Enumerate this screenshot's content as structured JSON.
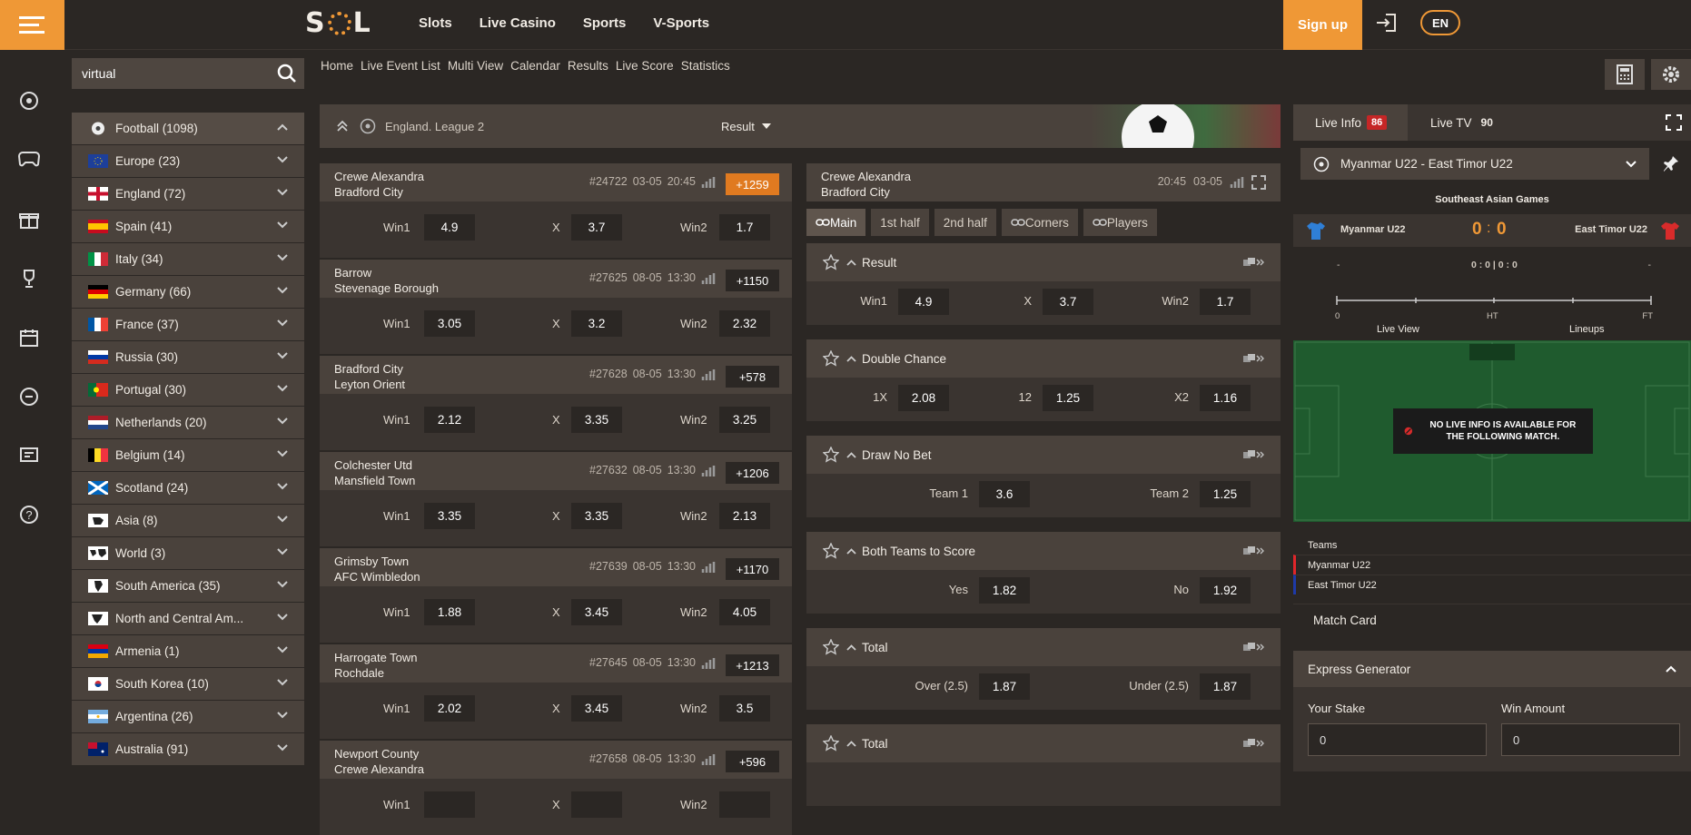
{
  "header": {
    "logo_text": "SOL",
    "nav": [
      "Slots",
      "Live Casino",
      "Sports",
      "V-Sports"
    ],
    "signup_label": "Sign up",
    "lang": "EN"
  },
  "search": {
    "value": "virtual"
  },
  "subnav": [
    "Home",
    "Live Event List",
    "Multi View",
    "Calendar",
    "Results",
    "Live Score",
    "Statistics"
  ],
  "sidebar": {
    "items": [
      {
        "label": "Football (1098)",
        "flag": "football"
      },
      {
        "label": "Europe (23)",
        "flag": "eu"
      },
      {
        "label": "England (72)",
        "flag": "england"
      },
      {
        "label": "Spain (41)",
        "flag": "spain"
      },
      {
        "label": "Italy (34)",
        "flag": "italy"
      },
      {
        "label": "Germany (66)",
        "flag": "germany"
      },
      {
        "label": "France (37)",
        "flag": "france"
      },
      {
        "label": "Russia (30)",
        "flag": "russia"
      },
      {
        "label": "Portugal (30)",
        "flag": "portugal"
      },
      {
        "label": "Netherlands (20)",
        "flag": "netherlands"
      },
      {
        "label": "Belgium (14)",
        "flag": "belgium"
      },
      {
        "label": "Scotland (24)",
        "flag": "scotland"
      },
      {
        "label": "Asia (8)",
        "flag": "asia"
      },
      {
        "label": "World (3)",
        "flag": "world"
      },
      {
        "label": "South America (35)",
        "flag": "samerica"
      },
      {
        "label": "North and Central Am...",
        "flag": "namerica"
      },
      {
        "label": "Armenia (1)",
        "flag": "armenia"
      },
      {
        "label": "South Korea (10)",
        "flag": "korea"
      },
      {
        "label": "Argentina (26)",
        "flag": "argentina"
      },
      {
        "label": "Australia (91)",
        "flag": "australia"
      }
    ]
  },
  "league": {
    "name": "England. League 2",
    "market_select": "Result"
  },
  "matches": [
    {
      "home": "Crewe Alexandra",
      "away": "Bradford City",
      "id": "#24722",
      "date": "03-05",
      "time": "20:45",
      "plus": "+1259",
      "hot": true,
      "w1": "4.9",
      "x": "3.7",
      "w2": "1.7"
    },
    {
      "home": "Barrow",
      "away": "Stevenage Borough",
      "id": "#27625",
      "date": "08-05",
      "time": "13:30",
      "plus": "+1150",
      "hot": false,
      "w1": "3.05",
      "x": "3.2",
      "w2": "2.32"
    },
    {
      "home": "Bradford City",
      "away": "Leyton Orient",
      "id": "#27628",
      "date": "08-05",
      "time": "13:30",
      "plus": "+578",
      "hot": false,
      "w1": "2.12",
      "x": "3.35",
      "w2": "3.25"
    },
    {
      "home": "Colchester Utd",
      "away": "Mansfield Town",
      "id": "#27632",
      "date": "08-05",
      "time": "13:30",
      "plus": "+1206",
      "hot": false,
      "w1": "3.35",
      "x": "3.35",
      "w2": "2.13"
    },
    {
      "home": "Grimsby Town",
      "away": "AFC Wimbledon",
      "id": "#27639",
      "date": "08-05",
      "time": "13:30",
      "plus": "+1170",
      "hot": false,
      "w1": "1.88",
      "x": "3.45",
      "w2": "4.05"
    },
    {
      "home": "Harrogate Town",
      "away": "Rochdale",
      "id": "#27645",
      "date": "08-05",
      "time": "13:30",
      "plus": "+1213",
      "hot": false,
      "w1": "2.02",
      "x": "3.45",
      "w2": "3.5"
    },
    {
      "home": "Newport County",
      "away": "Crewe Alexandra",
      "id": "#27658",
      "date": "08-05",
      "time": "13:30",
      "plus": "+596",
      "hot": false,
      "w1": "",
      "x": "",
      "w2": ""
    }
  ],
  "labels": {
    "win1": "Win1",
    "x": "X",
    "win2": "Win2"
  },
  "detail": {
    "home": "Crewe Alexandra",
    "away": "Bradford City",
    "time": "20:45",
    "date": "03-05",
    "tabs": [
      "Main",
      "1st half",
      "2nd half",
      "Corners",
      "Players"
    ],
    "markets": [
      {
        "title": "Result",
        "odds": [
          [
            "Win1",
            "4.9"
          ],
          [
            "X",
            "3.7"
          ],
          [
            "Win2",
            "1.7"
          ]
        ]
      },
      {
        "title": "Double Chance",
        "odds": [
          [
            "1X",
            "2.08"
          ],
          [
            "12",
            "1.25"
          ],
          [
            "X2",
            "1.16"
          ]
        ]
      },
      {
        "title": "Draw No Bet",
        "odds": [
          [
            "Team 1",
            "3.6"
          ],
          [
            "Team 2",
            "1.25"
          ]
        ]
      },
      {
        "title": "Both Teams to Score",
        "odds": [
          [
            "Yes",
            "1.82"
          ],
          [
            "No",
            "1.92"
          ]
        ]
      },
      {
        "title": "Total",
        "odds": [
          [
            "Over (2.5)",
            "1.87"
          ],
          [
            "Under (2.5)",
            "1.87"
          ]
        ]
      },
      {
        "title": "Total",
        "odds": []
      }
    ]
  },
  "live": {
    "info_label": "Live Info",
    "info_count": "86",
    "tv_label": "Live TV",
    "tv_count": "90",
    "match": "Myanmar U22 - East Timor U22",
    "competition": "Southeast Asian Games",
    "home": "Myanmar U22",
    "away": "East Timor U22",
    "score_home": "0",
    "score_away": "0",
    "dash_left": "-",
    "mid": "0 : 0 | 0 : 0",
    "dash_right": "-",
    "timeline": [
      "0",
      "HT",
      "FT"
    ],
    "live_view": "Live View",
    "lineups": "Lineups",
    "no_info": "NO LIVE INFO IS AVAILABLE FOR THE FOLLOWING MATCH.",
    "teams_label": "Teams",
    "match_card": "Match Card"
  },
  "express": {
    "title": "Express Generator",
    "stake_label": "Your Stake",
    "win_label": "Win Amount",
    "stake": "0",
    "win": "0"
  },
  "colors": {
    "accent": "#ef9836",
    "bg": "#2b2724",
    "panel": "#4a423c"
  }
}
